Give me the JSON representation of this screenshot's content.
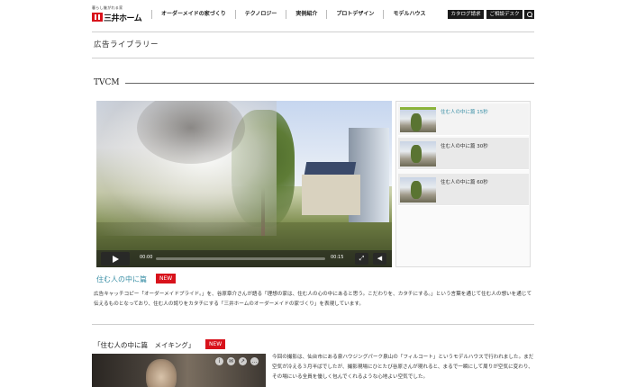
{
  "header": {
    "logo_tagline": "暮らし継がれる家",
    "logo_text": "三井ホーム",
    "nav": [
      "オーダーメイドの家づくり",
      "テクノロジー",
      "実例紹介",
      "プロトデザイン",
      "モデルハウス"
    ],
    "catalog_button": "カタログ請求",
    "desk_button": "ご相談デスク",
    "search_icon": "search-icon"
  },
  "page_title": "広告ライブラリー",
  "section": {
    "title": "TVCM"
  },
  "player": {
    "current_time": "00:00",
    "duration": "00:15",
    "progress": 0,
    "play_icon": "play-icon",
    "fullscreen_icon": "fullscreen-icon",
    "volume_icon": "volume-icon"
  },
  "playlist": [
    {
      "label": "住む人の中に篇 15秒",
      "active": true
    },
    {
      "label": "住む人の中に篇 30秒",
      "active": false
    },
    {
      "label": "住む人の中に篇 60秒",
      "active": false
    }
  ],
  "video_title": "住む人の中に篇",
  "badge": "NEW",
  "description": "広告キャッチコピー「オーダーメイドプライド。」を、谷原章介さんが語る「理想の家は、住む人の心の中にあると思う。こだわりを、カタチにする。」という言葉を通じて住む人の想いを通じて伝えるものとなっており、住む人の誇りをカタチにする「三井ホームのオーダーメイドの家づくり」を表現しています。",
  "making": {
    "title": "「住む人の中に篇　メイキング」",
    "badge": "NEW",
    "description": "今回の撮影は、仙台市にある泉ハウジングパーク泉山の「フィルコート」というモデルハウスで行われました。まだ空気が冷える３月半ばでしたが、撮影現場にひとたび谷原さんが現れると、まるで一瞬にして周りが空気に変わり、その場にいる全員を優しく包んでくれるような心地よい空気でした。",
    "icons": [
      "info-icon",
      "mail-icon",
      "share-icon",
      "more-icon"
    ]
  }
}
